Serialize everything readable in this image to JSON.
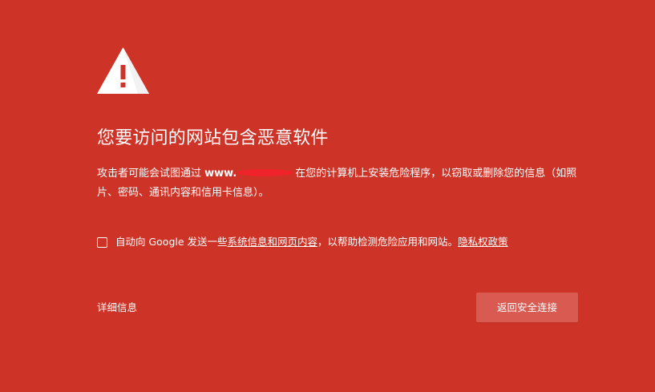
{
  "icon": "warning-triangle-icon",
  "colors": {
    "background": "#cd3327",
    "text": "#ffffff",
    "button": "#d85a51",
    "redaction": "#f0222a"
  },
  "heading": "您要访问的网站包含恶意软件",
  "explanation": {
    "before": "攻击者可能会试图通过 ",
    "domain": "www.",
    "after": "在您的计算机上安装危险程序，以窃取或删除您的信息（如照片、密码、通讯内容和信用卡信息）。"
  },
  "optin": {
    "checked": false,
    "text_before": "自动向 Google 发送一些",
    "link1": "系统信息和网页内容",
    "text_middle": "，以帮助检测危险应用和网站。",
    "link2": "隐私权政策"
  },
  "details_link": "详细信息",
  "primary_button": "返回安全连接"
}
